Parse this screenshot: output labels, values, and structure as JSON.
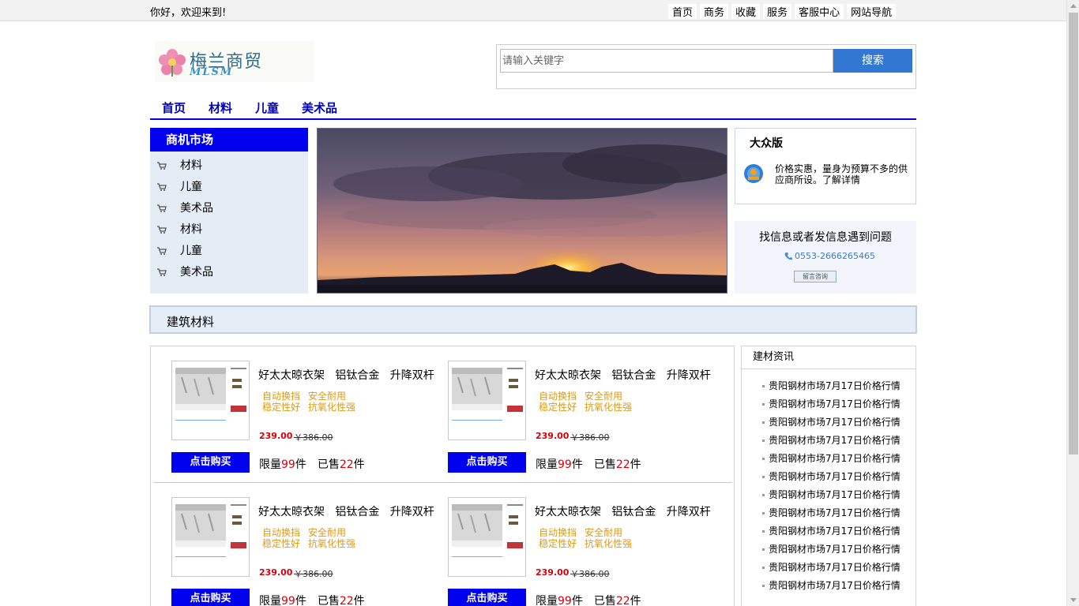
{
  "topbar": {
    "welcome": "你好，欢迎来到!",
    "nav": [
      "首页",
      "商务",
      "收藏",
      "服务",
      "客服中心",
      "网站导航"
    ]
  },
  "logo": {
    "name": "梅兰商贸",
    "sub": "MLSM"
  },
  "search": {
    "placeholder": "请输入关键字",
    "button": "搜索"
  },
  "mainnav": [
    "首页",
    "材料",
    "儿童",
    "美术品"
  ],
  "category": {
    "title": "商机市场",
    "items": [
      "材料",
      "儿童",
      "美术品",
      "材料",
      "儿童",
      "美术品"
    ]
  },
  "promo": {
    "title": "大众版",
    "desc": "价格实惠，量身为预算不多的供应商所设。了解详情"
  },
  "help": {
    "question": "找信息或者发信息遇到问题",
    "phone": "0553-2666265465",
    "button": "留言咨询"
  },
  "section": {
    "title": "建筑材料"
  },
  "products": [
    {
      "name": "好太太晾衣架   铝钛合金   升降双杆",
      "features": [
        "自动换挡",
        "安全耐用",
        "稳定性好",
        "抗氧化性强"
      ],
      "price": "239.00",
      "old_price": "￥386.00",
      "buy": "点击购买",
      "limit_label": "限量",
      "limit": "99",
      "unit": "件",
      "sold_label": "已售",
      "sold": "22",
      "sold_unit": "件"
    },
    {
      "name": "好太太晾衣架   铝钛合金   升降双杆",
      "features": [
        "自动换挡",
        "安全耐用",
        "稳定性好",
        "抗氧化性强"
      ],
      "price": "239.00",
      "old_price": "￥386.00",
      "buy": "点击购买",
      "limit_label": "限量",
      "limit": "99",
      "unit": "件",
      "sold_label": "已售",
      "sold": "22",
      "sold_unit": "件"
    },
    {
      "name": "好太太晾衣架   铝钛合金   升降双杆",
      "features": [
        "自动换挡",
        "安全耐用",
        "稳定性好",
        "抗氧化性强"
      ],
      "price": "239.00",
      "old_price": "￥386.00",
      "buy": "点击购买",
      "limit_label": "限量",
      "limit": "99",
      "unit": "件",
      "sold_label": "已售",
      "sold": "22",
      "sold_unit": "件"
    },
    {
      "name": "好太太晾衣架   铝钛合金   升降双杆",
      "features": [
        "自动换挡",
        "安全耐用",
        "稳定性好",
        "抗氧化性强"
      ],
      "price": "239.00",
      "old_price": "￥386.00",
      "buy": "点击购买",
      "limit_label": "限量",
      "limit": "99",
      "unit": "件",
      "sold_label": "已售",
      "sold": "22",
      "sold_unit": "件"
    }
  ],
  "news": {
    "title": "建材资讯",
    "items": [
      "贵阳钢材市场7月17日价格行情",
      "贵阳钢材市场7月17日价格行情",
      "贵阳钢材市场7月17日价格行情",
      "贵阳钢材市场7月17日价格行情",
      "贵阳钢材市场7月17日价格行情",
      "贵阳钢材市场7月17日价格行情",
      "贵阳钢材市场7月17日价格行情",
      "贵阳钢材市场7月17日价格行情",
      "贵阳钢材市场7月17日价格行情",
      "贵阳钢材市场7月17日价格行情",
      "贵阳钢材市场7月17日价格行情",
      "贵阳钢材市场7月17日价格行情"
    ]
  },
  "colors": {
    "accent": "#0000ee",
    "search": "#3278d2",
    "price": "#d0020c",
    "feature": "#d99a1a"
  }
}
